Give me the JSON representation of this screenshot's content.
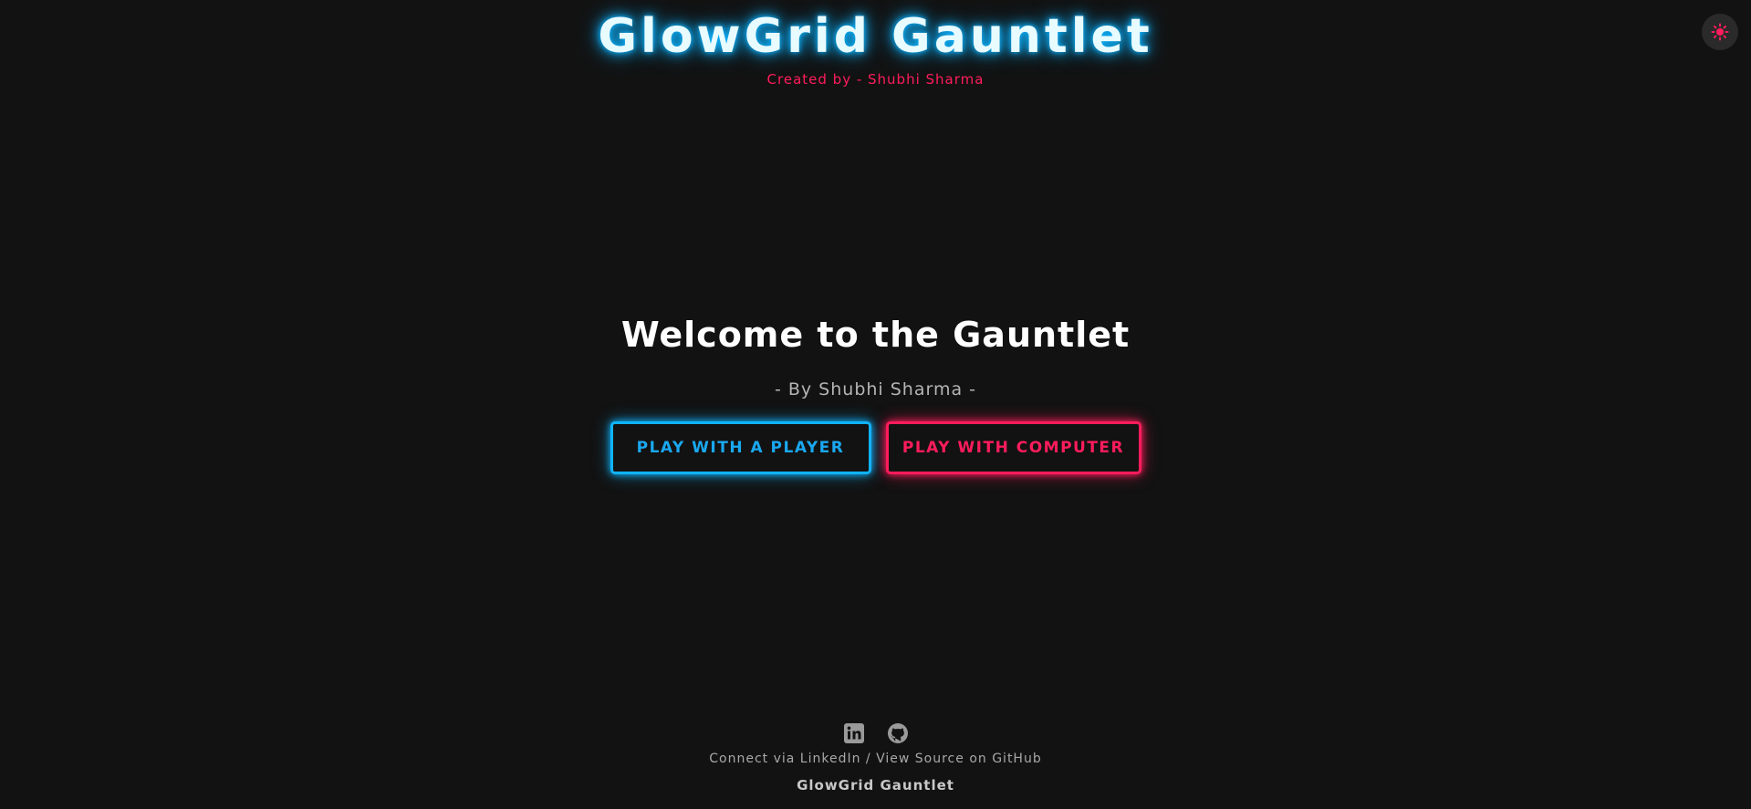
{
  "header": {
    "title": "GlowGrid Gauntlet",
    "creator": "Created by - Shubhi Sharma"
  },
  "theme_toggle": {
    "icon": "sun-icon"
  },
  "main": {
    "welcome": "Welcome to the Gauntlet",
    "byline": "- By Shubhi Sharma -",
    "buttons": {
      "player": "PLAY WITH A PLAYER",
      "computer": "PLAY WITH COMPUTER"
    }
  },
  "footer": {
    "icons": [
      "linkedin-icon",
      "github-icon"
    ],
    "linkedin_text": "Connect via LinkedIn",
    "separator": " / ",
    "github_text": "View Source on GitHub",
    "name": "GlowGrid Gauntlet"
  },
  "colors": {
    "background": "#121212",
    "neon_blue": "#0fb4ff",
    "neon_pink": "#ff1c5c"
  }
}
